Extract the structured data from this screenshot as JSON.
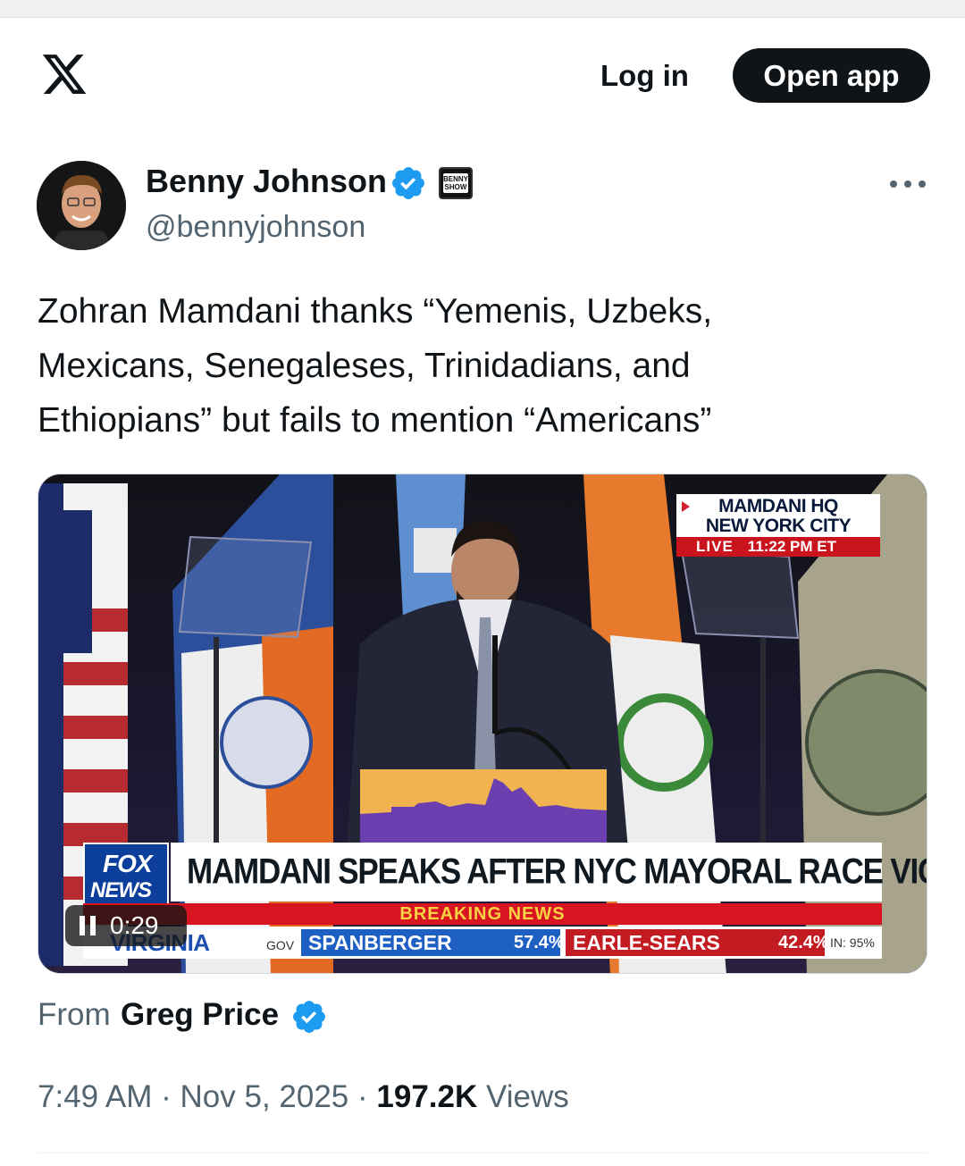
{
  "header": {
    "logo": "x-logo",
    "login_label": "Log in",
    "open_app_label": "Open app"
  },
  "author": {
    "display_name": "Benny Johnson",
    "handle": "@bennyjohnson",
    "verified": true,
    "affiliate_badge_text": "BENNY SHOW"
  },
  "tweet": {
    "text": "Zohran Mamdani thanks “Yemenis, Uzbeks,\nMexicans, Senegaleses, Trinidadians, and\nEthiopians” but fails to mention “Americans”"
  },
  "video": {
    "playback_time": "0:29",
    "bug": {
      "line1": "MAMDANI HQ",
      "line2": "NEW YORK CITY",
      "live": "LIVE",
      "time": "11:22 PM ET"
    },
    "network_logo_line1": "FOX",
    "network_logo_line2": "NEWS",
    "chyron_headline": "MAMDANI SPEAKS AFTER NYC MAYORAL RACE VICTORY",
    "breaking_label": "BREAKING NEWS",
    "ticker": {
      "state": "VIRGINIA",
      "race": "GOV",
      "dem_candidate": "SPANBERGER",
      "dem_pct": "57.4%",
      "rep_candidate": "EARLE-SEARS",
      "rep_pct": "42.4%",
      "reporting": "IN: 95%"
    }
  },
  "attribution": {
    "prefix": "From",
    "source_name": "Greg Price",
    "verified": true
  },
  "meta": {
    "time": "7:49 AM",
    "separator": " · ",
    "date": "Nov 5, 2025",
    "views_count": "197.2K",
    "views_label": "Views"
  },
  "colors": {
    "text_primary": "#0f1419",
    "text_secondary": "#536471",
    "verified_blue": "#1d9bf0",
    "fox_red": "#d7141f",
    "fox_blue": "#0c3f9c"
  }
}
